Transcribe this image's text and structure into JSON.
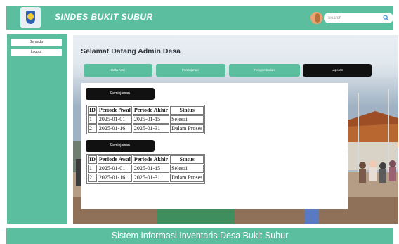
{
  "header": {
    "brand": "SINDES BUKIT SUBUR",
    "search_placeholder": "Search"
  },
  "sidebar": {
    "items": [
      {
        "label": "Beranda"
      },
      {
        "label": "Logout"
      }
    ]
  },
  "main": {
    "welcome": "Selamat Datang Admin Desa",
    "nav": [
      {
        "label": "Data Aset"
      },
      {
        "label": "Peminjaman"
      },
      {
        "label": "Pengembalian"
      },
      {
        "label": "Laporan"
      }
    ]
  },
  "reports": [
    {
      "title": "Peminjaman",
      "columns": [
        "ID",
        "Periode Awal",
        "Periode Akhir",
        "Status"
      ],
      "rows": [
        [
          "1",
          "2025-01-01",
          "2025-01-15",
          "Selesai"
        ],
        [
          "2",
          "2025-01-16",
          "2025-01-31",
          "Dalam Proses"
        ]
      ]
    },
    {
      "title": "Peminjaman",
      "columns": [
        "ID",
        "Periode Awal",
        "Periode Akhir",
        "Status"
      ],
      "rows": [
        [
          "1",
          "2025-01-01",
          "2025-01-15",
          "Selesai"
        ],
        [
          "2",
          "2025-01-16",
          "2025-01-31",
          "Dalam Proses"
        ]
      ]
    }
  ],
  "footer": {
    "text": "Sistem Informasi Inventaris Desa Bukit Subur"
  },
  "colors": {
    "accent": "#5bbf9f",
    "dark": "#111111",
    "panel": "#ffffff"
  },
  "icons": [
    "village-logo-icon",
    "user-avatar-icon",
    "search-icon"
  ]
}
